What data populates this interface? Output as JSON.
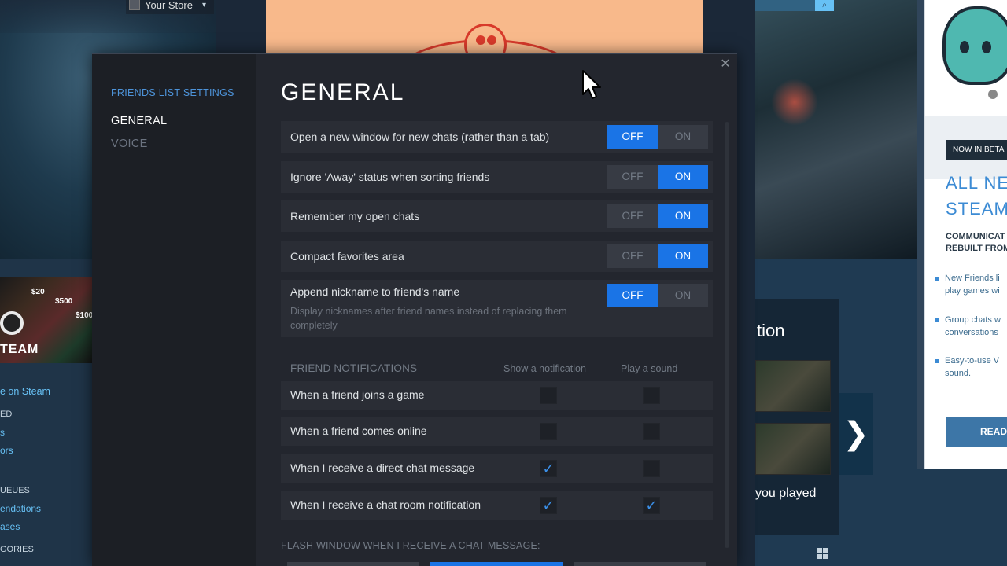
{
  "background": {
    "store_menu": "Your Store",
    "store_menu_caret": "▾",
    "gift_card_values": [
      "$20",
      "$500",
      "$100"
    ],
    "steam_logo_text": "TEAM",
    "left_links": {
      "on_steam": "e on Steam",
      "ed": "ED",
      "s": "s",
      "ors": "ors",
      "queues_head": "UEUES",
      "recommendations": "endations",
      "releases": "ases",
      "categories_head": "GORIES"
    },
    "tion_text": "tion",
    "you_played": "you played",
    "next_arrow": "❯",
    "beta": {
      "badge": "NOW IN BETA",
      "title_line1": "ALL NE",
      "title_line2": "STEAM",
      "subtitle_line1": "COMMUNICAT",
      "subtitle_line2": "REBUILT FROM",
      "bullet1_line1": "New Friends li",
      "bullet1_line2": "play games wi",
      "bullet2_line1": "Group chats w",
      "bullet2_line2": "conversations",
      "bullet3_line1": "Easy-to-use V",
      "bullet3_line2": "sound.",
      "read_button": "READ"
    }
  },
  "dialog": {
    "close_icon": "✕",
    "sidebar": {
      "section_title": "FRIENDS LIST SETTINGS",
      "items": [
        {
          "label": "GENERAL",
          "active": true
        },
        {
          "label": "VOICE",
          "active": false
        }
      ]
    },
    "title": "GENERAL",
    "settings": [
      {
        "label": "Open a new window for new chats (rather than a tab)",
        "off": "OFF",
        "on": "ON",
        "value": "OFF"
      },
      {
        "label": "Ignore 'Away' status when sorting friends",
        "off": "OFF",
        "on": "ON",
        "value": "ON"
      },
      {
        "label": "Remember my open chats",
        "off": "OFF",
        "on": "ON",
        "value": "ON"
      },
      {
        "label": "Compact favorites area",
        "off": "OFF",
        "on": "ON",
        "value": "ON"
      },
      {
        "label": "Append nickname to friend's name",
        "description": "Display nicknames after friend names instead of replacing them completely",
        "off": "OFF",
        "on": "ON",
        "value": "OFF"
      }
    ],
    "notifications": {
      "header": "FRIEND NOTIFICATIONS",
      "col_show": "Show a notification",
      "col_sound": "Play a sound",
      "check_glyph": "✓",
      "rows": [
        {
          "label": "When a friend joins a game",
          "show": false,
          "sound": false
        },
        {
          "label": "When a friend comes online",
          "show": false,
          "sound": false
        },
        {
          "label": "When I receive a direct chat message",
          "show": true,
          "sound": false
        },
        {
          "label": "When I receive a chat room notification",
          "show": true,
          "sound": true
        }
      ]
    },
    "flash": {
      "header": "FLASH WINDOW WHEN I RECEIVE A CHAT MESSAGE:",
      "selected_index": 1
    }
  },
  "colors": {
    "accent_blue": "#1a74e6",
    "link_blue": "#4d93d9",
    "dialog_bg": "#23262e",
    "row_bg": "#2a2d35"
  }
}
